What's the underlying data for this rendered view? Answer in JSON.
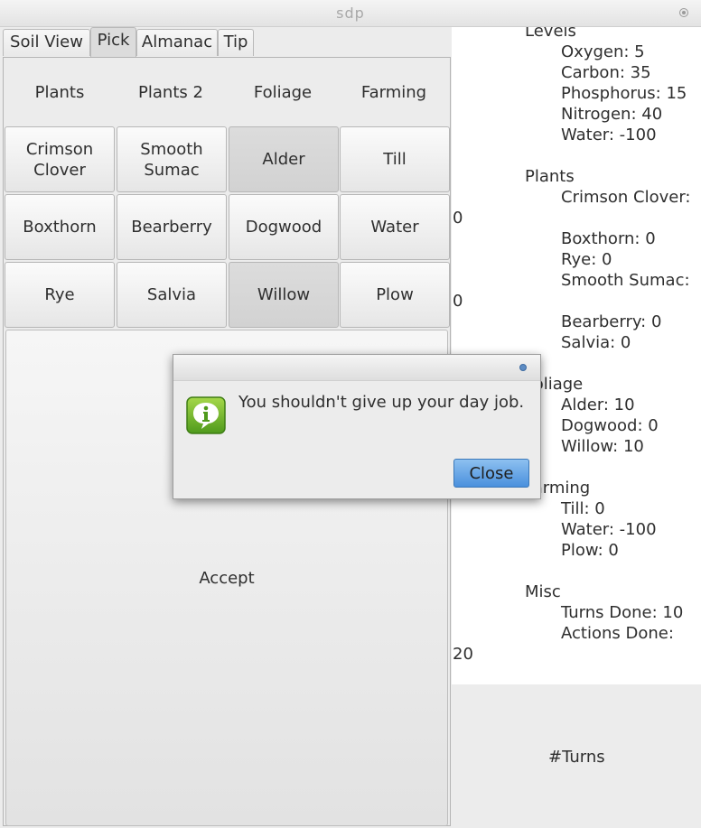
{
  "window": {
    "title": "sdp"
  },
  "tabs": [
    {
      "label": "Soil View"
    },
    {
      "label": "Pick"
    },
    {
      "label": "Almanac"
    },
    {
      "label": "Tip"
    }
  ],
  "pick": {
    "categories": [
      "Plants",
      "Plants 2",
      "Foliage",
      "Farming"
    ],
    "buttons": [
      [
        "Crimson Clover",
        "Smooth Sumac",
        "Alder",
        "Till"
      ],
      [
        "Boxthorn",
        "Bearberry",
        "Dogwood",
        "Water"
      ],
      [
        "Rye",
        "Salvia",
        "Willow",
        "Plow"
      ]
    ],
    "accept_label": "Accept"
  },
  "status": {
    "levels_heading": "Levels",
    "levels": [
      "Oxygen: 5",
      "Carbon: 35",
      "Phosphorus: 15",
      "Nitrogen: 40",
      "Water: -100"
    ],
    "plants_heading": "Plants",
    "crimson_clover": "Crimson Clover:",
    "crimson_clover_value": "0",
    "boxthorn": "Boxthorn: 0",
    "rye": "Rye: 0",
    "smooth_sumac": "Smooth Sumac:",
    "smooth_sumac_value": "0",
    "bearberry": "Bearberry: 0",
    "salvia": "Salvia: 0",
    "foliage_heading": "Foliage",
    "foliage": [
      "Alder: 10",
      "Dogwood: 0",
      "Willow: 10"
    ],
    "farming_heading": "Farming",
    "farming": [
      "Till: 0",
      "Water: -100",
      "Plow: 0"
    ],
    "misc_heading": "Misc",
    "turns_done": "Turns Done: 10",
    "actions_done": "Actions Done:",
    "actions_done_value": "20"
  },
  "turns_label": "#Turns",
  "dialog": {
    "message": "You shouldn't give up your day job.",
    "close_label": "Close",
    "icon": "info-icon"
  }
}
